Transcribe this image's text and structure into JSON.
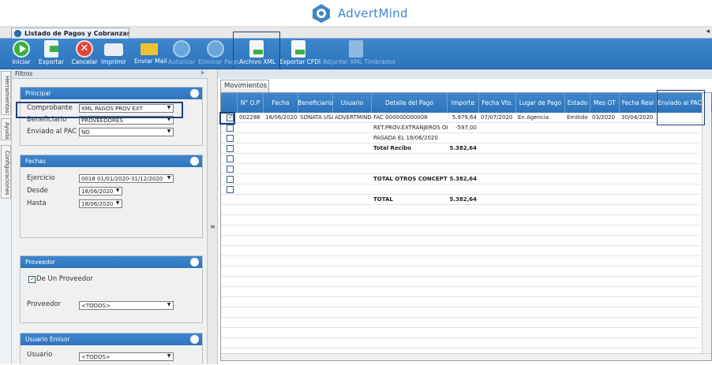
{
  "brand": {
    "name": "AdvertMind"
  },
  "document_tab": {
    "title": "Listado de Pagos y Cobranzas Det..."
  },
  "toolbar": {
    "buttons": [
      {
        "label": "Iniciar",
        "icon": "play-icon",
        "enabled": true
      },
      {
        "label": "Exportar",
        "icon": "export-icon",
        "enabled": true
      },
      {
        "label": "Cancelar",
        "icon": "cancel-icon",
        "enabled": true
      },
      {
        "label": "Imprimir",
        "icon": "printer-icon",
        "enabled": true
      },
      {
        "label": "Enviar Mail",
        "icon": "mail-icon",
        "enabled": true
      },
      {
        "label": "Autorizar",
        "icon": "authorize-icon",
        "enabled": false
      },
      {
        "label": "Eliminar Pago",
        "icon": "delete-payment-icon",
        "enabled": false
      },
      {
        "label": "Archivo XML",
        "icon": "xml-file-icon",
        "enabled": true
      },
      {
        "label": "Exportar CFDI",
        "icon": "cfdi-export-icon",
        "enabled": true
      },
      {
        "label": "Adjuntar XML Timbrados",
        "icon": "attach-xml-icon",
        "enabled": false
      }
    ]
  },
  "side_rail": {
    "tabs": [
      "Herramientas",
      "Ayuda",
      "Configuraciones"
    ]
  },
  "filters": {
    "title": "Filtros",
    "principal": {
      "header": "Principal",
      "comprobante_label": "Comprobante",
      "comprobante_value": "XML PAGOS PROV EXT",
      "beneficiario_label": "Beneficiario",
      "beneficiario_value": "PROVEEDORES",
      "enviado_label": "Enviado al PAC",
      "enviado_value": "NO"
    },
    "fechas": {
      "header": "Fechas",
      "ejercicio_label": "Ejercicio",
      "ejercicio_value": "0018 01/01/2020-31/12/2020",
      "desde_label": "Desde",
      "desde_value": "18/06/2020",
      "hasta_label": "Hasta",
      "hasta_value": "18/06/2020"
    },
    "proveedor": {
      "header": "Proveedor",
      "checkbox_label": "De Un Proveedor",
      "checked": true,
      "proveedor_label": "Proveedor",
      "proveedor_value": "<TODOS>"
    },
    "usuario_emisor": {
      "header": "Usuario Emisor",
      "usuario_label": "Usuario",
      "usuario_value": "<TODOS>"
    }
  },
  "main": {
    "tab_label": "Movimientos",
    "columns": [
      "N° O.P",
      "Fecha",
      "Beneficiario",
      "Usuario",
      "Detalle del Pago",
      "Importe",
      "Fecha Vto.",
      "Lugar de Pago",
      "Estado",
      "Mes OT",
      "Fecha Real",
      "Enviado al PAC"
    ],
    "rows": [
      {
        "checked": true,
        "op": "002286",
        "fecha": "18/06/2020",
        "beneficiario": "SONATA USA",
        "usuario": "ADVERTMIND",
        "detalle": "FAC 000000000008",
        "importe": "5.979,64",
        "vto": "07/07/2020",
        "lugar": "En Agencia",
        "estado": "Emitido",
        "mes": "03/2020",
        "real": "30/04/2020",
        "enviado": "",
        "bold": false
      },
      {
        "checked": false,
        "op": "",
        "fecha": "",
        "beneficiario": "",
        "usuario": "",
        "detalle": "RET.PROV.EXTRANJEROS OP",
        "importe": "-597,00",
        "vto": "",
        "lugar": "",
        "estado": "",
        "mes": "",
        "real": "",
        "enviado": "",
        "bold": false
      },
      {
        "checked": false,
        "op": "",
        "fecha": "",
        "beneficiario": "",
        "usuario": "",
        "detalle": "PAGADA EL 18/06/2020",
        "importe": "",
        "vto": "",
        "lugar": "",
        "estado": "",
        "mes": "",
        "real": "",
        "enviado": "",
        "bold": false
      },
      {
        "checked": false,
        "op": "",
        "fecha": "",
        "beneficiario": "",
        "usuario": "",
        "detalle": "Total Recibo",
        "importe": "5.382,64",
        "vto": "",
        "lugar": "",
        "estado": "",
        "mes": "",
        "real": "",
        "enviado": "",
        "bold": true
      },
      {
        "checked": false,
        "op": "",
        "fecha": "",
        "beneficiario": "",
        "usuario": "",
        "detalle": "",
        "importe": "",
        "vto": "",
        "lugar": "",
        "estado": "",
        "mes": "",
        "real": "",
        "enviado": "",
        "bold": false
      },
      {
        "checked": false,
        "op": "",
        "fecha": "",
        "beneficiario": "",
        "usuario": "",
        "detalle": "",
        "importe": "",
        "vto": "",
        "lugar": "",
        "estado": "",
        "mes": "",
        "real": "",
        "enviado": "",
        "bold": false
      },
      {
        "checked": false,
        "op": "",
        "fecha": "",
        "beneficiario": "",
        "usuario": "",
        "detalle": "TOTAL OTROS CONCEPTOS",
        "importe": "5.382,64",
        "vto": "",
        "lugar": "",
        "estado": "",
        "mes": "",
        "real": "",
        "enviado": "",
        "bold": true
      },
      {
        "checked": false,
        "op": "",
        "fecha": "",
        "beneficiario": "",
        "usuario": "",
        "detalle": "",
        "importe": "",
        "vto": "",
        "lugar": "",
        "estado": "",
        "mes": "",
        "real": "",
        "enviado": "",
        "bold": false
      },
      {
        "checked": null,
        "op": "",
        "fecha": "",
        "beneficiario": "",
        "usuario": "",
        "detalle": "TOTAL",
        "importe": "5.382,64",
        "vto": "",
        "lugar": "",
        "estado": "",
        "mes": "",
        "real": "",
        "enviado": "",
        "bold": true
      }
    ]
  },
  "colors": {
    "accent": "#2f78c2",
    "highlight": "#1f3f7a",
    "brand": "#3f86c6"
  }
}
